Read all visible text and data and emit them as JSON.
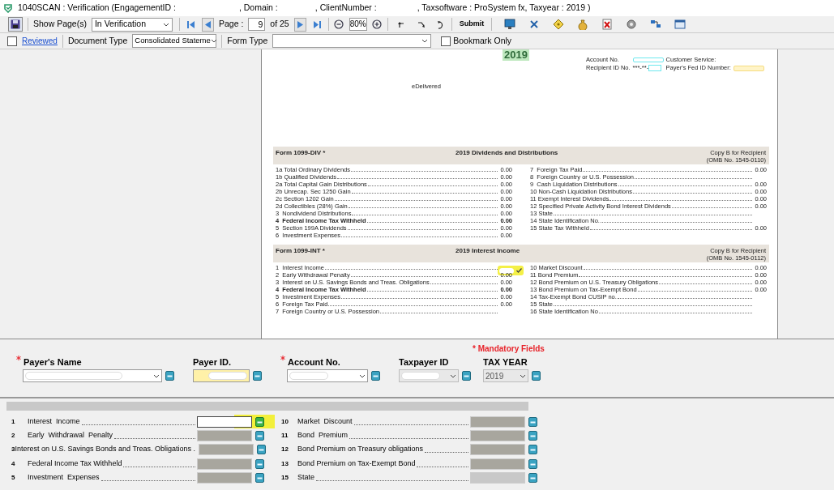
{
  "window": {
    "title_parts": [
      "1040SCAN : Verification (EngagementID :",
      ", Domain :",
      ", ClientNumber :",
      ", Taxsoftware : ProSystem fx, Taxyear : 2019 )"
    ]
  },
  "toolbar": {
    "show_pages_label": "Show Page(s)",
    "show_pages_value": "In Verification",
    "page_label": "Page :",
    "page_value": "9",
    "page_total": "of 25",
    "zoom_value": "80%",
    "submit": "Submit"
  },
  "filter_bar": {
    "reviewed": {
      "label": "Reviewed",
      "checked": false
    },
    "document_type": {
      "label": "Document Type",
      "value": "Consolidated Stateme"
    },
    "form_type": {
      "label": "Form Type"
    },
    "bookmark_only": {
      "label": "Bookmark Only",
      "checked": false
    }
  },
  "document": {
    "year": "2019",
    "account_no_label": "Account No.",
    "customer_service": "Customer Service:",
    "recipient_id_label": "Recipient ID No.",
    "recipient_id_value": "***-**-",
    "payer_fed_id_label": "Payer's Fed ID Number:",
    "edelivered": "eDelivered",
    "sections": [
      {
        "form": "Form 1099-DIV *",
        "heading": "2019 Dividends and Distributions",
        "copy": "Copy B for Recipient",
        "omb": "(OMB No. 1545-0110)",
        "left": [
          {
            "label": "1a Total Ordinary Dividends",
            "value": "0.00",
            "bold": false,
            "highlighted": false
          },
          {
            "label": "1b Qualified Dividends",
            "value": "0.00",
            "bold": false,
            "highlighted": false
          },
          {
            "label": "2a Total Capital Gain Distributions",
            "value": "0.00",
            "bold": false,
            "highlighted": false
          },
          {
            "label": "2b Unrecap. Sec 1250 Gain",
            "value": "0.00",
            "bold": false,
            "highlighted": false
          },
          {
            "label": "2c Section 1202 Gain",
            "value": "0.00",
            "bold": false,
            "highlighted": false
          },
          {
            "label": "2d Collectibles (28%) Gain",
            "value": "0.00",
            "bold": false,
            "highlighted": false
          },
          {
            "label": "3  Nondividend Distributions",
            "value": "0.00",
            "bold": false,
            "highlighted": false
          },
          {
            "label": "4  Federal Income Tax Withheld",
            "value": "0.00",
            "bold": true,
            "highlighted": false
          },
          {
            "label": "5  Section 199A Dividends",
            "value": "0.00",
            "bold": false,
            "highlighted": false
          },
          {
            "label": "6  Investment Expenses",
            "value": "0.00",
            "bold": false,
            "highlighted": false
          }
        ],
        "right": [
          {
            "label": "7  Foreign Tax Paid",
            "value": "0.00",
            "bold": false,
            "highlighted": false
          },
          {
            "label": "8  Foreign Country or U.S. Possession",
            "bold": false,
            "highlighted": false
          },
          {
            "label": "9  Cash Liquidation Distributions",
            "value": "0.00",
            "bold": false,
            "highlighted": false
          },
          {
            "label": "10 Non-Cash Liquidation Distributions",
            "value": "0.00",
            "bold": false,
            "highlighted": false
          },
          {
            "label": "11 Exempt Interest Dividends",
            "value": "0.00",
            "bold": false,
            "highlighted": false
          },
          {
            "label": "12 Specified Private Activity Bond Interest Dividends",
            "value": "0.00",
            "bold": false,
            "highlighted": false
          },
          {
            "label": "13 State",
            "bold": false,
            "highlighted": false
          },
          {
            "label": "14 State Identification No.",
            "bold": false,
            "highlighted": false
          },
          {
            "label": "15 State Tax Withheld",
            "value": "0.00",
            "bold": false,
            "highlighted": false
          }
        ]
      },
      {
        "form": "Form 1099-INT *",
        "heading": "2019 Interest Income",
        "copy": "Copy B for Recipient",
        "omb": "(OMB No. 1545-0112)",
        "left": [
          {
            "label": "1  Interest Income",
            "bold": false,
            "highlighted": true
          },
          {
            "label": "2  Early Withdrawal Penalty",
            "value": "0.00",
            "bold": false,
            "highlighted": false
          },
          {
            "label": "3  Interest on U.S. Savings Bonds and Treas. Obligations",
            "value": "0.00",
            "bold": false,
            "highlighted": false
          },
          {
            "label": "4  Federal Income Tax Withheld",
            "value": "0.00",
            "bold": true,
            "highlighted": false
          },
          {
            "label": "5  Investment Expenses",
            "value": "0.00",
            "bold": false,
            "highlighted": false
          },
          {
            "label": "6  Foreign Tax Paid",
            "value": "0.00",
            "bold": false,
            "highlighted": false
          },
          {
            "label": "7  Foreign Country or U.S. Possession",
            "bold": false,
            "highlighted": false
          }
        ],
        "right": [
          {
            "label": "10 Market Discount",
            "value": "0.00",
            "bold": false,
            "highlighted": false
          },
          {
            "label": "11 Bond Premium",
            "value": "0.00",
            "bold": false,
            "highlighted": false
          },
          {
            "label": "12 Bond Premium on U.S. Treasury Obligations",
            "value": "0.00",
            "bold": false,
            "highlighted": false
          },
          {
            "label": "13 Bond Premium on Tax-Exempt Bond",
            "value": "0.00",
            "bold": false,
            "highlighted": false
          },
          {
            "label": "14 Tax-Exempt Bond CUSIP no.",
            "bold": false,
            "highlighted": false
          },
          {
            "label": "15 State",
            "bold": false,
            "highlighted": false
          },
          {
            "label": "16 State Identification No",
            "bold": false,
            "highlighted": false
          }
        ]
      }
    ]
  },
  "header_form": {
    "mandatory_note": "* Mandatory Fields",
    "fields": [
      {
        "label": "Payer's Name",
        "required": true,
        "kind": "combo",
        "disabled": false,
        "highlighted": false,
        "redacted": true
      },
      {
        "label": "Payer ID.",
        "required": false,
        "kind": "text",
        "disabled": false,
        "highlighted": true,
        "redacted": true
      },
      {
        "label": "Account No.",
        "required": true,
        "kind": "combo",
        "disabled": false,
        "highlighted": false,
        "redacted": true
      },
      {
        "label": "Taxpayer ID",
        "required": false,
        "kind": "combo",
        "disabled": true,
        "highlighted": false,
        "redacted": true
      },
      {
        "label": "TAX YEAR",
        "required": false,
        "kind": "combo",
        "disabled": true,
        "highlighted": false,
        "redacted": false,
        "value": "2019"
      }
    ]
  },
  "entry_form": {
    "left": [
      {
        "num": "1",
        "label": "Interest  Income",
        "active": true
      },
      {
        "num": "2",
        "label": "Early  Withdrawal  Penalty",
        "active": false
      },
      {
        "num": "3",
        "label": "Interest on U.S. Savings Bonds and Treas. Obligations .",
        "active": false
      },
      {
        "num": "4",
        "label": "Federal Income Tax Withheld",
        "active": false
      },
      {
        "num": "5",
        "label": "Investment  Expenses",
        "active": false
      }
    ],
    "right": [
      {
        "num": "10",
        "label": "Market  Discount",
        "active": false
      },
      {
        "num": "11",
        "label": "Bond  Premium",
        "active": false
      },
      {
        "num": "12",
        "label": "Bond Premium on Treasury obligations",
        "active": false
      },
      {
        "num": "13",
        "label": "Bond Premium on Tax-Exempt Bond",
        "active": false
      },
      {
        "num": "15",
        "label": "State",
        "active": false
      }
    ]
  }
}
